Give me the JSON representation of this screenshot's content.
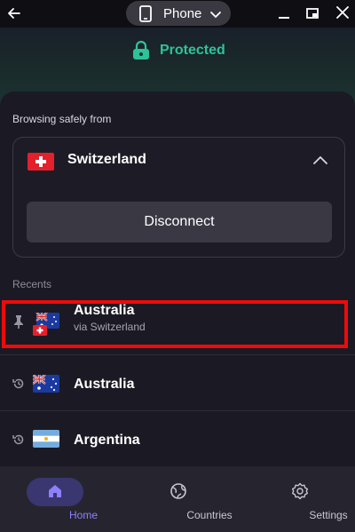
{
  "titlebar": {
    "device_label": "Phone",
    "icons": [
      "back-arrow-icon",
      "phone-icon",
      "chevron-down-icon",
      "minimize-icon",
      "picture-in-picture-icon",
      "close-icon"
    ]
  },
  "status": {
    "text": "Protected",
    "icon": "lock-icon",
    "color": "#2ec29a"
  },
  "connection": {
    "label": "Browsing safely from",
    "country": "Switzerland",
    "flag": "switzerland-flag",
    "disconnect_label": "Disconnect"
  },
  "recents": {
    "label": "Recents",
    "items": [
      {
        "name": "Australia",
        "via": "via Switzerland",
        "icon": "pin-icon",
        "flag": "australia-flag"
      },
      {
        "name": "Australia",
        "icon": "history-icon",
        "flag": "australia-flag"
      },
      {
        "name": "Argentina",
        "icon": "history-icon",
        "flag": "argentina-flag"
      }
    ]
  },
  "nav": {
    "items": [
      {
        "label": "Home",
        "icon": "home-icon",
        "active": true
      },
      {
        "label": "Countries",
        "icon": "globe-icon",
        "active": false
      },
      {
        "label": "Settings",
        "icon": "gear-icon",
        "active": false
      }
    ]
  },
  "colors": {
    "accent": "#8d80ff",
    "protected_green": "#2ec29a",
    "highlight": "#ee0a0a",
    "background": "#1b1a24"
  }
}
